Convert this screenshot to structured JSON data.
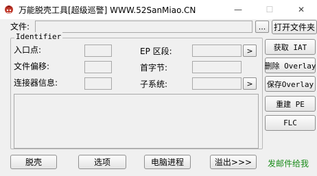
{
  "window": {
    "title": "万能脱壳工具[超级巡警]    WWW.52SanMiao.CN",
    "minimize_glyph": "—",
    "maximize_glyph": "☐",
    "close_glyph": "✕"
  },
  "file_row": {
    "label": "文件:",
    "value": "",
    "browse_label": "...",
    "open_label": "打开文件夹"
  },
  "identifier": {
    "legend": "Identifier",
    "entry_point_label": "入口点:",
    "entry_point_value": "",
    "file_offset_label": "文件偏移:",
    "file_offset_value": "",
    "linker_info_label": "连接器信息:",
    "linker_info_value": "",
    "ep_section_label": "EP  区段:",
    "ep_section_value": "",
    "first_byte_label": "首字节:",
    "first_byte_value": "",
    "subsystem_label": "子系统:",
    "subsystem_value": "",
    "more_glyph": ">"
  },
  "log": {
    "text": ""
  },
  "side_buttons": {
    "get_iat": "获取 IAT",
    "delete_overlay": "删除 Overlay",
    "save_overlay": "保存Overlay",
    "rebuild_pe": "重建 PE",
    "flc": "FLC"
  },
  "bottom_buttons": {
    "unpack": "脱壳",
    "options": "选项",
    "processes": "电脑进程",
    "overflow": "溢出>>>"
  },
  "status": {
    "text": "发邮件给我"
  },
  "colors": {
    "status_green": "#1a8c1a",
    "titlebar_bg": "#ffffff",
    "window_bg": "#f0f0f0"
  }
}
